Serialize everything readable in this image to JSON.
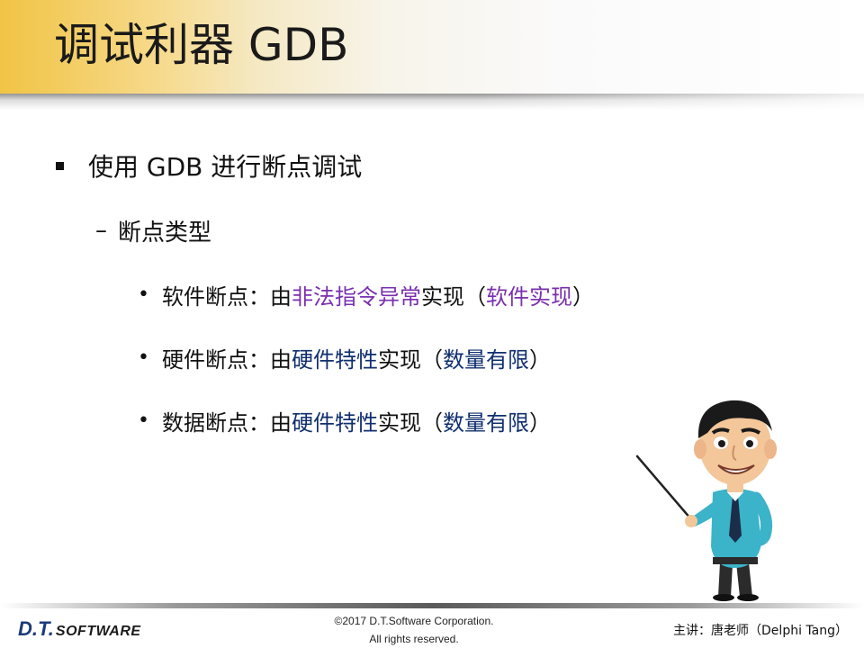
{
  "title": "调试利器 GDB",
  "content": {
    "level1": {
      "text": "使用 GDB 进行断点调试"
    },
    "level2": {
      "marker": "–",
      "text": "断点类型"
    },
    "items": [
      {
        "name": "软件断点",
        "sep": "：由",
        "mechanism": "非法指令异常",
        "mid": "实现（",
        "note": "软件实现",
        "end": "）"
      },
      {
        "name": "硬件断点",
        "sep": "：由",
        "mechanism": "硬件特性",
        "mid": "实现（",
        "note": "数量有限",
        "end": "）"
      },
      {
        "name": "数据断点",
        "sep": "：由",
        "mechanism": "硬件特性",
        "mid": "实现（",
        "note": "数量有限",
        "end": "）"
      }
    ]
  },
  "footer": {
    "logo_main": "D.T.",
    "logo_sub": "SOFTWARE",
    "copyright_line1": "©2017 D.T.Software Corporation.",
    "copyright_line2": "All rights reserved.",
    "speaker": "主讲：唐老师（Delphi Tang）"
  },
  "colors": {
    "title_gradient_start": "#f1c445",
    "highlight_purple": "#7a2fae",
    "highlight_navy": "#0f2f6e"
  },
  "icons": {
    "teacher": "cartoon-teacher-with-pointer-illustration"
  }
}
